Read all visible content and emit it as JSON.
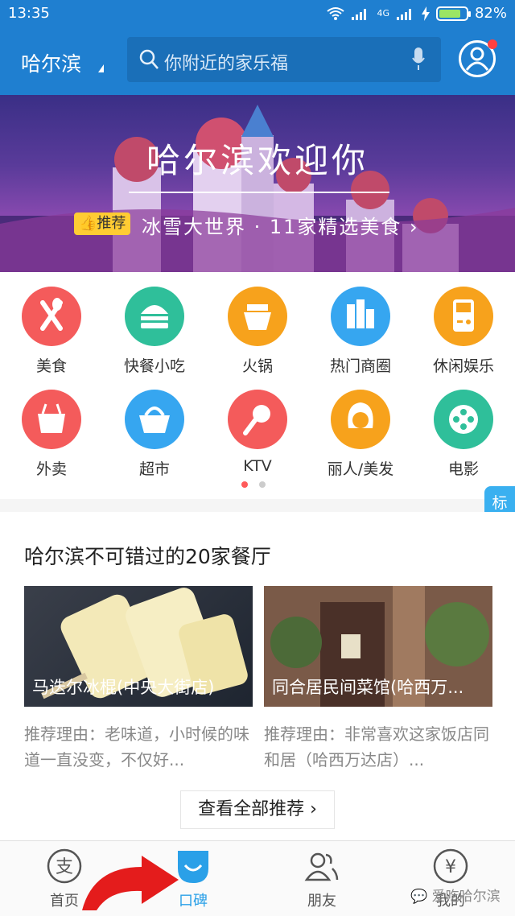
{
  "status_bar": {
    "time": "13:35",
    "network": "4G",
    "battery": "82%",
    "battery_level": 0.82
  },
  "header": {
    "city": "哈尔滨",
    "search_placeholder": "你附近的家乐福"
  },
  "banner": {
    "title": "哈尔滨欢迎你",
    "badge": "推荐",
    "subtitle": "冰雪大世界 · 11家精选美食 ›"
  },
  "categories": [
    {
      "label": "美食",
      "color": "#f45b5b",
      "icon": "fork-spoon-icon"
    },
    {
      "label": "快餐小吃",
      "color": "#2fbf9a",
      "icon": "burger-icon"
    },
    {
      "label": "火锅",
      "color": "#f7a21c",
      "icon": "hotpot-icon"
    },
    {
      "label": "热门商圈",
      "color": "#36a6f0",
      "icon": "buildings-icon"
    },
    {
      "label": "休闲娱乐",
      "color": "#f7a21c",
      "icon": "gamepad-icon"
    },
    {
      "label": "外卖",
      "color": "#f45b5b",
      "icon": "takeout-box-icon"
    },
    {
      "label": "超市",
      "color": "#36a6f0",
      "icon": "basket-icon"
    },
    {
      "label": "KTV",
      "color": "#f45b5b",
      "icon": "microphone-icon"
    },
    {
      "label": "丽人/美发",
      "color": "#f7a21c",
      "icon": "beauty-face-icon"
    },
    {
      "label": "电影",
      "color": "#2fbf9a",
      "icon": "film-reel-icon"
    }
  ],
  "side_tab": {
    "label": "标准版"
  },
  "recommend": {
    "title": "哈尔滨不可错过的20家餐厅",
    "cards": [
      {
        "name": "马迭尔冰棍(中央大街店)",
        "reason": "推荐理由：老味道，小时候的味道一直没变，不仅好..."
      },
      {
        "name": "同合居民间菜馆(哈西万...",
        "reason": "推荐理由：非常喜欢这家饭店同和居（哈西万达店）..."
      }
    ],
    "see_all": "查看全部推荐 ›"
  },
  "bottom_nav": [
    {
      "label": "首页",
      "icon": "alipay-home-icon"
    },
    {
      "label": "口碑",
      "icon": "koubei-smile-icon"
    },
    {
      "label": "朋友",
      "icon": "friends-icon"
    },
    {
      "label": "我的",
      "icon": "wallet-yen-icon"
    }
  ],
  "watermark": "爱吃哈尔滨"
}
